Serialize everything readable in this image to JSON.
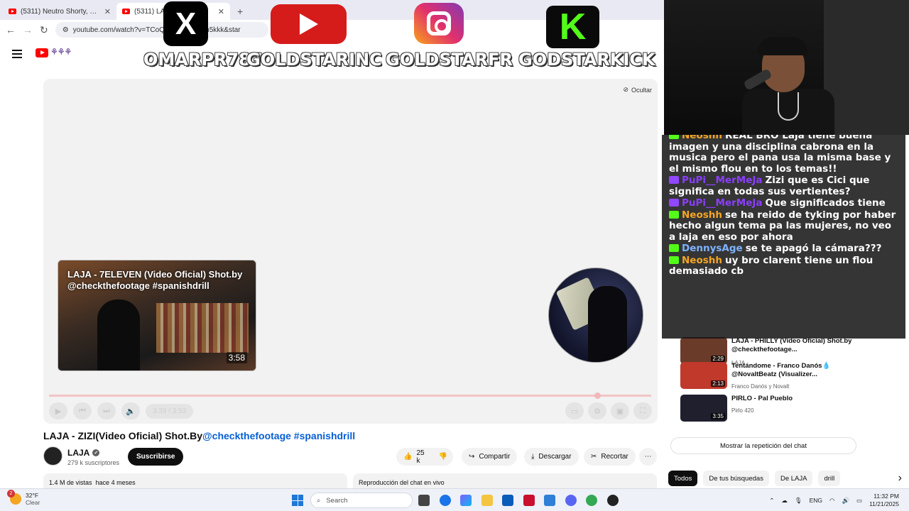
{
  "browser": {
    "tabs": [
      {
        "title": "(5311) Neutro Shorty, Young L..."
      },
      {
        "title": "(5311) LAJA..."
      }
    ],
    "new_tab": "+",
    "url": "youtube.com/watch?v=TCoQ...DTCoQX6m5kkk&star"
  },
  "overlay": {
    "handles": [
      "OMARPR787",
      "GOLDSTARINC",
      "GOLDSTARFR",
      "GODSTARKICK"
    ],
    "x_glyph": "X",
    "kick_glyph": "K"
  },
  "player": {
    "hide_label": "Ocultar",
    "next_card": {
      "title": "LAJA - 7ELEVEN (Video Oficial) Shot.by @checkthefootage #spanishdrill",
      "duration": "3:58"
    },
    "time_display": "3:39 / 3:53",
    "progress_fraction": 0.91
  },
  "video": {
    "title_main": "LAJA - ZIZI(Video Oficial) Shot.By",
    "title_tags": "@checkthefootage #spanishdrill",
    "channel": "LAJA",
    "subscribers": "279 k suscriptores",
    "subscribe_label": "Suscribirse",
    "likes": "25 k",
    "share_label": "Compartir",
    "download_label": "Descargar",
    "clip_label": "Recortar",
    "more_label": "⋯",
    "views": "1.4 M de vistas",
    "age": "hace 4 meses",
    "chat_replay_label": "Reproducción del chat en vivo"
  },
  "chat": [
    {
      "platform": "kick",
      "user": "Neoshh",
      "user_color": "#f5a623",
      "text": "REAL BRO Laja tiene buena imagen y una disciplina cabrona en la musica pero el pana usa la misma base y el mismo flou en to los temas!!"
    },
    {
      "platform": "twitch",
      "user": "PuPi__MerMeJa",
      "user_color": "#8a3ffc",
      "text": "Zizi que es Cici que significa en todas sus vertientes?"
    },
    {
      "platform": "twitch",
      "user": "PuPi__MerMeJa",
      "user_color": "#8a3ffc",
      "text": "Que significados tiene"
    },
    {
      "platform": "kick",
      "user": "Neoshh",
      "user_color": "#f5a623",
      "text": "se ha reido de tyking por haber hecho algun tema pa las mujeres, no veo a laja en eso por ahora"
    },
    {
      "platform": "kick",
      "user": "DennysAge",
      "user_color": "#7fb2ff",
      "text": "se te apagó la cámara???"
    },
    {
      "platform": "kick",
      "user": "Neoshh",
      "user_color": "#f5a623",
      "text": "uy bro clarent tiene un flou demasiado cb"
    }
  ],
  "recommended": [
    {
      "title": "LAJA - PHILLY (Video Oficial) Shot.by @checkthefootage...",
      "channel": "LAJA",
      "duration": "2:29",
      "thumb_color": "#6b3b2a"
    },
    {
      "title": "Tentándome - Franco Danós💧 @NovaltBeatz (Visualizer...",
      "channel": "Franco Danós y Novalt",
      "duration": "2:13",
      "thumb_color": "#c0392b"
    },
    {
      "title": "PIRLO - Pal Pueblo",
      "channel": "Pirlo 420",
      "duration": "3:35",
      "thumb_color": "#1f1f2e"
    }
  ],
  "sidebar": {
    "show_replay_label": "Mostrar la repetición del chat",
    "chips": [
      "Todos",
      "De tus búsquedas",
      "De LAJA",
      "drill"
    ],
    "chip_next": "›"
  },
  "taskbar": {
    "weather_temp": "32°F",
    "weather_cond": "Clear",
    "weather_badge": "2",
    "search_label": "Search",
    "lang": "ENG",
    "time": "11:32 PM",
    "date": "11/21/2025"
  }
}
